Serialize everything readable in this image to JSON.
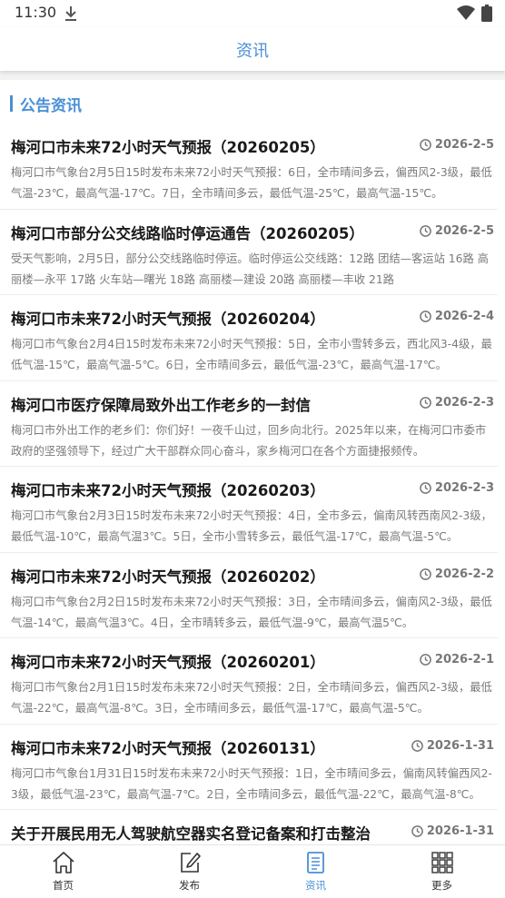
{
  "status_bar": {
    "time": "11:30"
  },
  "header": {
    "title": "资讯"
  },
  "section": {
    "title": "公告资讯"
  },
  "news": [
    {
      "title": "梅河口市未来72小时天气预报（20260205）",
      "date": "2026-2-5",
      "summary": "梅河口市气象台2月5日15时发布未来72小时天气预报：6日，全市晴间多云，偏西风2-3级，最低气温-23℃，最高气温-17℃。7日，全市晴间多云，最低气温-25℃，最高气温-15℃。"
    },
    {
      "title": "梅河口市部分公交线路临时停运通告（20260205）",
      "date": "2026-2-5",
      "summary": "受天气影响，2月5日，部分公交线路临时停运。临时停运公交线路：12路 团结—客运站 16路 高丽楼—永平 17路 火车站—曙光 18路 高丽楼—建设 20路 高丽楼—丰收 21路"
    },
    {
      "title": "梅河口市未来72小时天气预报（20260204）",
      "date": "2026-2-4",
      "summary": "梅河口市气象台2月4日15时发布未来72小时天气预报：5日，全市小雪转多云，西北风3-4级，最低气温-15℃，最高气温-5℃。6日，全市晴间多云，最低气温-23℃，最高气温-17℃。"
    },
    {
      "title": "梅河口市医疗保障局致外出工作老乡的一封信",
      "date": "2026-2-3",
      "summary": "梅河口市外出工作的老乡们：你们好！一夜千山过，回乡向北行。2025年以来，在梅河口市委市政府的坚强领导下，经过广大干部群众同心奋斗，家乡梅河口在各个方面捷报频传。"
    },
    {
      "title": "梅河口市未来72小时天气预报（20260203）",
      "date": "2026-2-3",
      "summary": "梅河口市气象台2月3日15时发布未来72小时天气预报：4日，全市多云，偏南风转西南风2-3级，最低气温-10℃，最高气温3℃。5日，全市小雪转多云，最低气温-17℃，最高气温-5℃。"
    },
    {
      "title": "梅河口市未来72小时天气预报（20260202）",
      "date": "2026-2-2",
      "summary": "梅河口市气象台2月2日15时发布未来72小时天气预报：3日，全市晴间多云，偏南风2-3级，最低气温-14℃，最高气温3℃。4日，全市晴转多云，最低气温-9℃，最高气温5℃。"
    },
    {
      "title": "梅河口市未来72小时天气预报（20260201）",
      "date": "2026-2-1",
      "summary": "梅河口市气象台2月1日15时发布未来72小时天气预报：2日，全市晴间多云，偏西风2-3级，最低气温-22℃，最高气温-8℃。3日，全市晴间多云，最低气温-17℃，最高气温-5℃。"
    },
    {
      "title": "梅河口市未来72小时天气预报（20260131）",
      "date": "2026-1-31",
      "summary": "梅河口市气象台1月31日15时发布未来72小时天气预报：1日，全市晴间多云，偏南风转偏西风2-3级，最低气温-23℃，最高气温-7℃。2日，全市晴间多云，最低气温-22℃，最高气温-8℃。"
    },
    {
      "title": "关于开展民用无人驾驶航空器实名登记备案和打击整治",
      "date": "2026-1-31",
      "summary": ""
    }
  ],
  "tabs": [
    {
      "label": "首页",
      "icon": "home-icon"
    },
    {
      "label": "发布",
      "icon": "edit-icon"
    },
    {
      "label": "资讯",
      "icon": "news-icon"
    },
    {
      "label": "更多",
      "icon": "grid-icon"
    }
  ],
  "colors": {
    "accent": "#4a8fd6",
    "text": "#1a1a1a",
    "muted": "#7a7a7a"
  }
}
